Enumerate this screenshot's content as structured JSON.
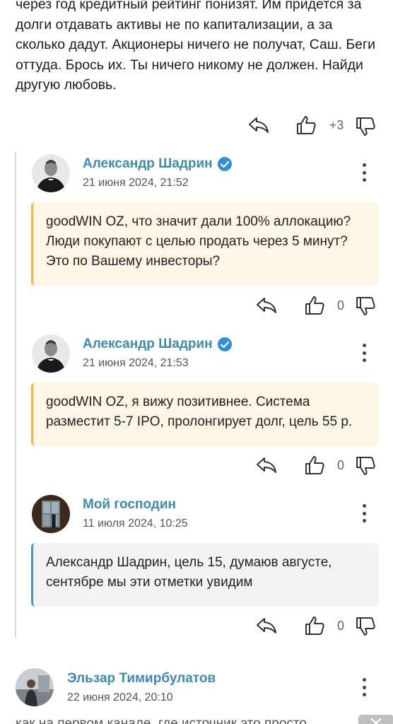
{
  "top_comment": {
    "text": "через год кредитный рейтинг понизят. Им придется за долги отдавать активы не по капитализации, а за сколько дадут. Акционеры ничего не получат, Саш. Беги оттуда. Брось их. Ты ничего никому не должен. Найди другую любовь.",
    "like_count": "+3"
  },
  "replies": [
    {
      "author": "Александр Шадрин",
      "verified": true,
      "date": "21 июня 2024, 21:52",
      "text": "goodWIN OZ, что значит дали 100% аллокацию? Люди покупают с целью продать через 5 минут? Это по Вашему инвесторы?",
      "like_count": "0"
    },
    {
      "author": "Александр Шадрин",
      "verified": true,
      "date": "21 июня 2024, 21:53",
      "text": "goodWIN OZ, я вижу позитивнее. Система разместит 5-7 IPO, пролонгирует долг, цель 55 р.",
      "like_count": "0"
    },
    {
      "author": "Мой господин",
      "verified": false,
      "date": "11 июля 2024, 10:25",
      "text": "Александр Шадрин, цель 15, думаюв августе, сентябре мы эти отметки увидим",
      "like_count": "0"
    }
  ],
  "next_comment": {
    "author": "Эльзар Тимирбулатов",
    "date": "22 июня 2024, 20:10",
    "text_partial": "как на первом канале, где источник это просто"
  },
  "icons": {
    "reply": "reply-arrow-icon",
    "like": "thumbs-up-icon",
    "dislike": "thumbs-down-icon",
    "menu": "more-vertical-icon",
    "verified": "verified-check-icon",
    "close": "close-icon"
  },
  "colors": {
    "author": "#3d8bb0",
    "verified": "#2f8fd8",
    "quote_yellow_bg": "#fdf6e6",
    "quote_yellow_border": "#f0b840",
    "quote_grey_bg": "#f3f3f3",
    "quote_blue_border": "#4a94c8"
  }
}
